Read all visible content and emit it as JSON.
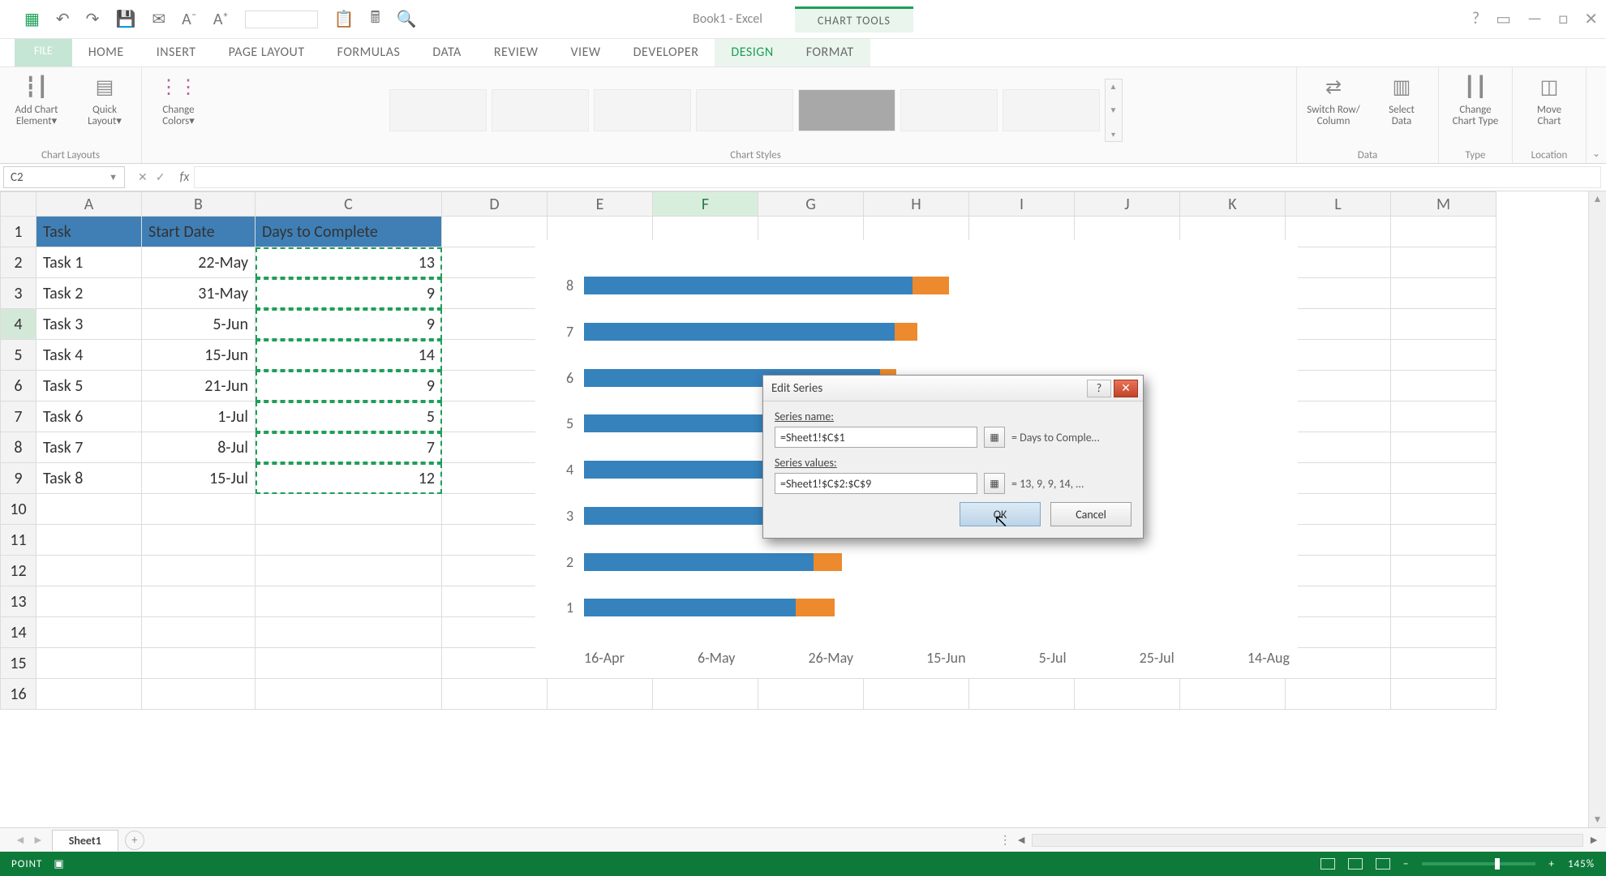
{
  "app": {
    "title": "Book1 - Excel",
    "charttools": "CHART TOOLS"
  },
  "window_controls": {
    "help": "?",
    "restore": "▭",
    "min": "—",
    "max": "□",
    "close": "✕"
  },
  "qat": [
    "↶",
    "↷",
    "💾",
    "✉",
    "A⁻",
    "A⁺",
    "",
    "📋",
    "🖩",
    "🔍"
  ],
  "tabs": {
    "file": "FILE",
    "items": [
      "HOME",
      "INSERT",
      "PAGE LAYOUT",
      "FORMULAS",
      "DATA",
      "REVIEW",
      "VIEW",
      "DEVELOPER"
    ],
    "ct": [
      "DESIGN",
      "FORMAT"
    ],
    "active": "DESIGN"
  },
  "ribbon": {
    "chart_layouts": {
      "label": "Chart Layouts",
      "add_chart_element": "Add Chart Element▾",
      "quick_layout": "Quick Layout▾"
    },
    "change_colors": "Change Colors▾",
    "chart_styles_label": "Chart Styles",
    "data": {
      "label": "Data",
      "switch": "Switch Row/\nColumn",
      "select": "Select\nData"
    },
    "type": {
      "label": "Type",
      "change": "Change\nChart Type"
    },
    "location": {
      "label": "Location",
      "move": "Move\nChart"
    }
  },
  "namebox": "C2",
  "columns": [
    "A",
    "B",
    "C",
    "D",
    "E",
    "F",
    "G",
    "H",
    "I",
    "J",
    "K",
    "L",
    "M"
  ],
  "highlight_col": "F",
  "highlight_row": 4,
  "header_row": {
    "a": "Task",
    "b": "Start Date",
    "c": "Days to Complete"
  },
  "rows": [
    {
      "a": "Task 1",
      "b": "22-May",
      "c": "13"
    },
    {
      "a": "Task 2",
      "b": "31-May",
      "c": "9"
    },
    {
      "a": "Task 3",
      "b": "5-Jun",
      "c": "9"
    },
    {
      "a": "Task 4",
      "b": "15-Jun",
      "c": "14"
    },
    {
      "a": "Task 5",
      "b": "21-Jun",
      "c": "9"
    },
    {
      "a": "Task 6",
      "b": "1-Jul",
      "c": "5"
    },
    {
      "a": "Task 7",
      "b": "8-Jul",
      "c": "7"
    },
    {
      "a": "Task 8",
      "b": "15-Jul",
      "c": "12"
    }
  ],
  "extra_row_labels": [
    "10",
    "11",
    "12",
    "13",
    "14",
    "15",
    "16"
  ],
  "chart_data": {
    "type": "bar",
    "orientation": "horizontal",
    "xlabel": "",
    "ylabel": "",
    "categories": [
      "1",
      "2",
      "3",
      "4",
      "5",
      "6",
      "7",
      "8"
    ],
    "x_ticks": [
      "16-Apr",
      "6-May",
      "26-May",
      "15-Jun",
      "5-Jul",
      "25-Jul",
      "14-Aug"
    ],
    "series": [
      {
        "name": "Start Date",
        "color": "#3682bd",
        "values_pct": [
          30,
          32.5,
          34,
          37,
          39,
          42,
          44,
          46.5
        ]
      },
      {
        "name": "Days to Complete",
        "color": "#ec8a2d",
        "values_pct": [
          5.5,
          4,
          4,
          6,
          4,
          2.3,
          3.2,
          5.2
        ]
      }
    ],
    "note": "values_pct are approximate bar-length percentages read from pixels; Days values map to data rows 13,9,9,14,9,5,7,12"
  },
  "dialog": {
    "title": "Edit Series",
    "series_name_label": "Series name:",
    "series_name_value": "=Sheet1!$C$1",
    "series_name_eval": "= Days to Comple…",
    "series_values_label": "Series values:",
    "series_values_value": "=Sheet1!$C$2:$C$9",
    "series_values_eval": "= 13, 9, 9, 14, …",
    "ok": "OK",
    "cancel": "Cancel"
  },
  "sheet_tabs": {
    "active": "Sheet1"
  },
  "status": {
    "mode": "POINT",
    "zoom": "145%"
  }
}
